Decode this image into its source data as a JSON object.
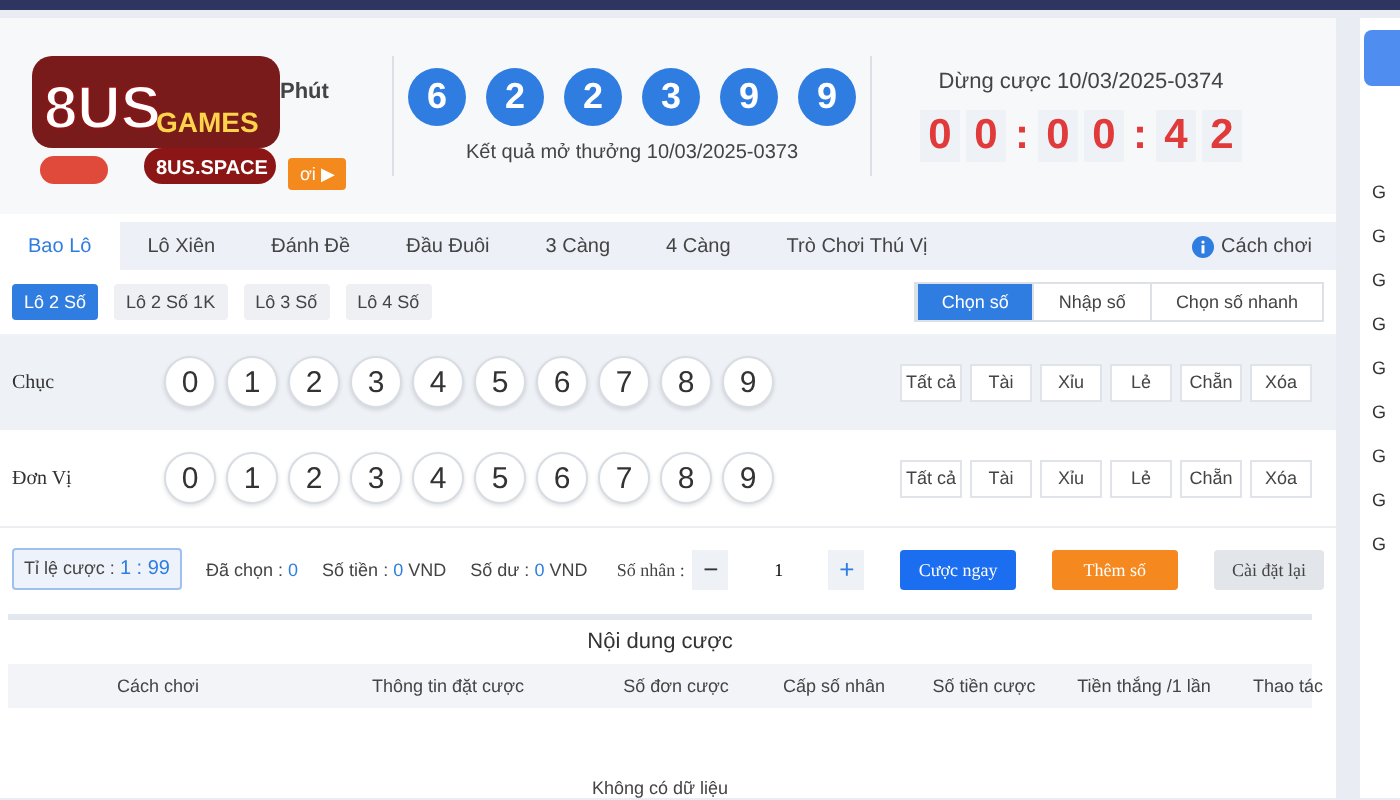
{
  "logo": {
    "brand": "8US",
    "games": "GAMES",
    "site": "8US.SPACE",
    "side_text": "Phút",
    "cta": "ơi ▶"
  },
  "results": {
    "balls": [
      "6",
      "2",
      "2",
      "3",
      "9",
      "9"
    ],
    "caption": "Kết quả mở thưởng 10/03/2025-0373"
  },
  "countdown": {
    "label": "Dừng cược 10/03/2025-0374",
    "digits": [
      "0",
      "0",
      ":",
      "0",
      "0",
      ":",
      "4",
      "2"
    ]
  },
  "tabs": [
    {
      "label": "Bao Lô",
      "selected": true
    },
    {
      "label": "Lô Xiên",
      "selected": false
    },
    {
      "label": "Đánh Đề",
      "selected": false
    },
    {
      "label": "Đầu Đuôi",
      "selected": false
    },
    {
      "label": "3 Càng",
      "selected": false
    },
    {
      "label": "4 Càng",
      "selected": false
    },
    {
      "label": "Trò Chơi Thú Vị",
      "selected": false
    }
  ],
  "help": "Cách chơi",
  "subtabs": [
    {
      "label": "Lô 2 Số",
      "selected": true
    },
    {
      "label": "Lô 2 Số 1K",
      "selected": false
    },
    {
      "label": "Lô 3 Số",
      "selected": false
    },
    {
      "label": "Lô 4 Số",
      "selected": false
    }
  ],
  "modes": [
    {
      "label": "Chọn số",
      "selected": true
    },
    {
      "label": "Nhập số",
      "selected": false
    },
    {
      "label": "Chọn số nhanh",
      "selected": false
    }
  ],
  "pick_rows": [
    {
      "label": "Chục",
      "numbers": [
        "0",
        "1",
        "2",
        "3",
        "4",
        "5",
        "6",
        "7",
        "8",
        "9"
      ],
      "quick": [
        "Tất cả",
        "Tài",
        "Xỉu",
        "Lẻ",
        "Chẵn",
        "Xóa"
      ]
    },
    {
      "label": "Đơn Vị",
      "numbers": [
        "0",
        "1",
        "2",
        "3",
        "4",
        "5",
        "6",
        "7",
        "8",
        "9"
      ],
      "quick": [
        "Tất cả",
        "Tài",
        "Xỉu",
        "Lẻ",
        "Chẵn",
        "Xóa"
      ]
    }
  ],
  "summary": {
    "odds_label": "Tỉ lệ cược :",
    "odds": "1 : 99",
    "stats": [
      {
        "label": "Đã chọn :",
        "value": "0"
      },
      {
        "label": "Số tiền :",
        "value": "0",
        "unit": "VND"
      },
      {
        "label": "Số dư :",
        "value": "0",
        "unit": "VND"
      }
    ]
  },
  "multiplier": {
    "label": "Số nhân :",
    "minus": "−",
    "value": "1",
    "plus": "+"
  },
  "actions": [
    {
      "label": "Cược ngay",
      "kind": "primary"
    },
    {
      "label": "Thêm số",
      "kind": "warning"
    },
    {
      "label": "Cài đặt lại",
      "kind": "plain"
    }
  ],
  "bet_table": {
    "title": "Nội dung cược",
    "columns": [
      "Cách chơi",
      "Thông tin đặt cược",
      "Số đơn cược",
      "Cấp số nhân",
      "Số tiền cược",
      "Tiền thắng /1 lần",
      "Thao tác"
    ],
    "empty": "Không có dữ liệu"
  },
  "side_panel": {
    "items": [
      "G",
      "G",
      "G",
      "G",
      "G",
      "G",
      "G",
      "G",
      "G"
    ]
  }
}
